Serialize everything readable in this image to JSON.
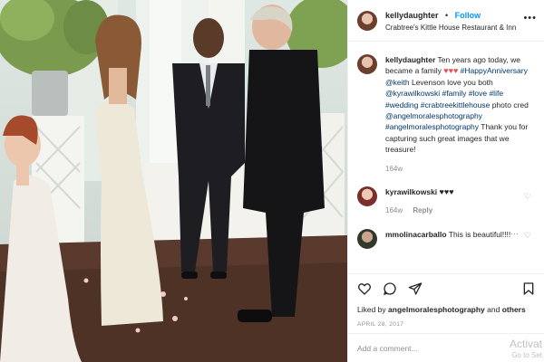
{
  "post": {
    "header": {
      "username": "kellydaughter",
      "follow_label": "Follow",
      "location": "Crabtree's Kittle House Restaurant & Inn",
      "more_icon": "ellipsis-icon"
    },
    "caption": {
      "username": "kellydaughter",
      "text_lead": "Ten years ago today, we became a family",
      "hearts": "♥♥♥",
      "hashtag_anniv": "#HappyAnniversary",
      "mention_keith": "@keith",
      "text_mid": "Levenson love you both",
      "mention_kyra": "@kyrawilkowski",
      "tags_line": "#family #love #life #wedding #crabtreekittlehouse",
      "text_photo": "photo cred",
      "mention_angel": "@angelmoralesphotography",
      "hashtag_angel": "#angelmoralesphotography",
      "text_end": "Thank you for capturing such great images that we treasure!",
      "age": "164w"
    },
    "comments": [
      {
        "username": "kyrawilkowski",
        "text": "♥♥♥",
        "age": "164w",
        "reply_label": "Reply"
      },
      {
        "username": "mmolinacarballo",
        "text": "This is beautiful!!!!"
      }
    ],
    "likes": {
      "prefix": "Liked by",
      "user": "angelmoralesphotography",
      "and": "and",
      "others": "others"
    },
    "date": "APRIL 28, 2017",
    "add_comment_placeholder": "Add a comment...",
    "watermark": {
      "line1": "Activat",
      "line2": "Go to Set"
    },
    "colors": {
      "link": "#00376b",
      "follow": "#0095f6",
      "heart": "#ed4956"
    }
  }
}
